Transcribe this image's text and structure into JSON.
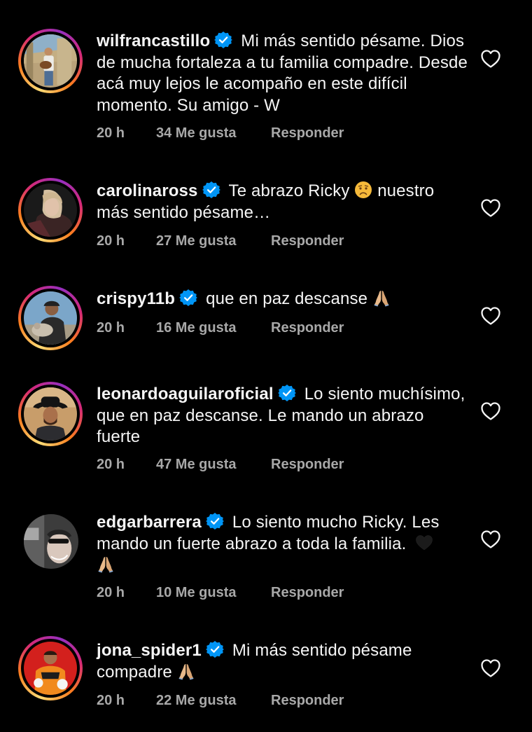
{
  "comments": [
    {
      "username": "wilfrancastillo",
      "text": "Mi más sentido pésame. Dios  de mucha fortaleza a tu familia compadre. Desde acá muy lejos le acompaño en este difícil momento. Su amigo - W",
      "emoji": "",
      "time": "20 h",
      "likes": "34 Me gusta",
      "reply": "Responder",
      "avatar_icon": "profile-photo"
    },
    {
      "username": "carolinaross",
      "text": "Te abrazo Ricky",
      "emoji": "sad-face-emoji",
      "text_after": "nuestro más sentido pésame…",
      "time": "20 h",
      "likes": "27 Me gusta",
      "reply": "Responder",
      "avatar_icon": "profile-photo"
    },
    {
      "username": "crispy11b",
      "text": "que en paz descanse",
      "emoji": "folded-hands-emoji",
      "time": "20 h",
      "likes": "16 Me gusta",
      "reply": "Responder",
      "avatar_icon": "profile-photo"
    },
    {
      "username": "leonardoaguilaroficial",
      "text": "Lo siento muchísimo, que en paz descanse. Le mando un abrazo fuerte",
      "emoji": "",
      "time": "20 h",
      "likes": "47 Me gusta",
      "reply": "Responder",
      "avatar_icon": "profile-photo"
    },
    {
      "username": "edgarbarrera",
      "text": "Lo siento mucho Ricky. Les mando un fuerte abrazo a toda la familia.",
      "emoji": "black-heart-emoji, folded-hands-emoji",
      "time": "20 h",
      "likes": "10 Me gusta",
      "reply": "Responder",
      "avatar_icon": "profile-photo"
    },
    {
      "username": "jona_spider1",
      "text": "Mi más sentido pésame compadre",
      "emoji": "folded-hands-emoji",
      "time": "20 h",
      "likes": "22 Me gusta",
      "reply": "Responder",
      "avatar_icon": "profile-photo"
    }
  ],
  "colors": {
    "background": "#000000",
    "text": "#f5f5f5",
    "meta": "#a8a8a8",
    "verified": "#0095f6"
  },
  "icons": {
    "verified": "verified-badge-icon",
    "like": "heart-outline-icon"
  }
}
